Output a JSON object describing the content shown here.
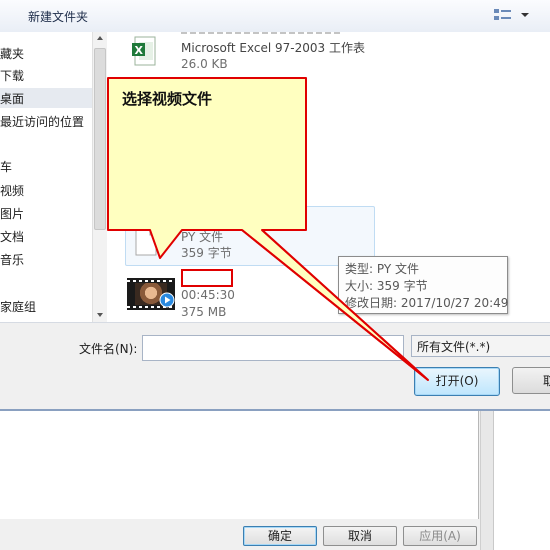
{
  "toolbar": {
    "new_folder": "新建文件夹",
    "view_icon": "view-options-icon",
    "dropdown_icon": "chevron-down-icon"
  },
  "nav": {
    "items": [
      {
        "label": "藏夹"
      },
      {
        "label": "下载"
      },
      {
        "label": "桌面"
      },
      {
        "label": "最近访问的位置"
      },
      {
        "label": "车"
      },
      {
        "label": "视频"
      },
      {
        "label": "图片"
      },
      {
        "label": "文档"
      },
      {
        "label": "音乐"
      },
      {
        "label": "家庭组"
      }
    ]
  },
  "files": {
    "excel": {
      "type": "Microsoft Excel 97-2003 工作表",
      "size": "26.0 KB"
    },
    "py": {
      "type": "PY 文件",
      "size": "359 字节"
    },
    "video": {
      "duration": "00:45:30",
      "size": "375 MB"
    }
  },
  "tooltip": {
    "type": "类型: PY 文件",
    "size": "大小: 359 字节",
    "modified": "修改日期: 2017/10/27 20:49"
  },
  "bottom": {
    "filename_label": "文件名(N):",
    "filename_value": "",
    "filetype": "所有文件(*.*)",
    "open": "打开(O)",
    "cancel": "取"
  },
  "under": {
    "ok": "确定",
    "cancel": "取消",
    "apply": "应用(A)"
  },
  "annotation": {
    "text": "选择视频文件",
    "color": "#ffffc0",
    "border": "#e00000"
  }
}
